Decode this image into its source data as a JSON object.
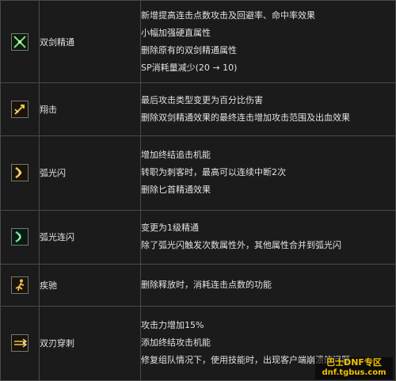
{
  "rows": [
    {
      "icon": "crossed-swords-icon",
      "name": "双剑精通",
      "desc": [
        "新增提高连击点数攻击及回避率、命中率效果",
        "小幅加强硬直属性",
        "删除原有的双剑精通属性",
        "SP消耗量减少(20 → 10)"
      ]
    },
    {
      "icon": "leap-strike-icon",
      "name": "翔击",
      "desc": [
        "最后攻击类型变更为百分比伤害",
        "删除双剑精通效果的最终连击增加攻击范围及出血效果"
      ]
    },
    {
      "icon": "arc-flash-icon",
      "name": "弧光闪",
      "desc": [
        "增加终结追击机能",
        "转职为刺客时，最高可以连续中断2次",
        "删除匕首精通效果"
      ]
    },
    {
      "icon": "arc-flash-combo-icon",
      "name": "弧光连闪",
      "desc": [
        "变更为1级精通",
        "除了弧光闪触发次数属性外，其他属性合并到弧光闪"
      ]
    },
    {
      "icon": "sprint-icon",
      "name": "疾驰",
      "desc": [
        "删除释放时，消耗连击点数的功能"
      ]
    },
    {
      "icon": "twin-blade-pierce-icon",
      "name": "双刃穿刺",
      "desc": [
        "攻击力增加15%",
        "添加终结攻击机能",
        "修复组队情况下，使用技能时，出现客户端崩溃的问题"
      ]
    }
  ],
  "watermark": {
    "title": "巴士DNF专区",
    "url": "dnf.tgbus.com"
  },
  "colors": {
    "background": "#1b1b1b",
    "border": "#4a4a4a",
    "text": "#e2e2e2",
    "watermark": "#f2c200"
  }
}
